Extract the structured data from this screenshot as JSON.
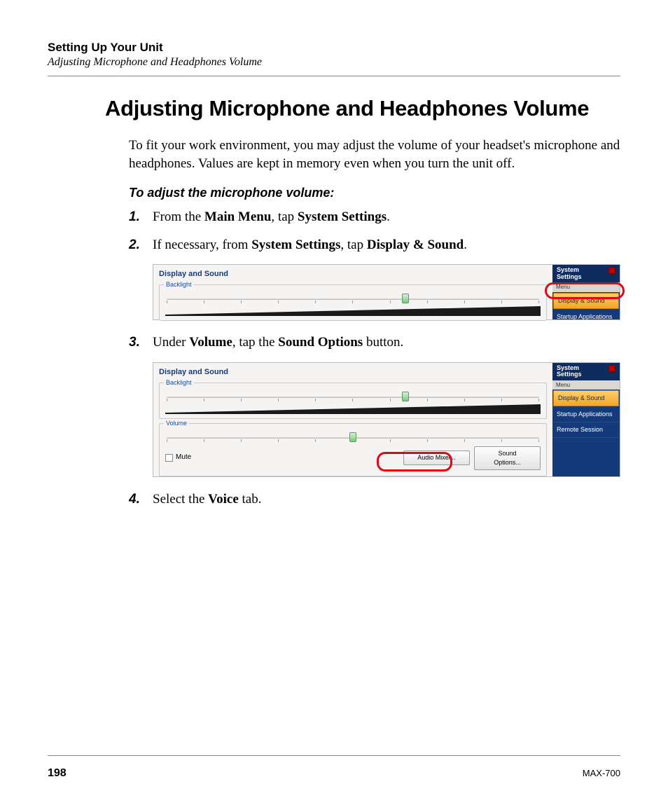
{
  "header": {
    "chapter": "Setting Up Your Unit",
    "section": "Adjusting Microphone and Headphones Volume"
  },
  "title": "Adjusting Microphone and Headphones Volume",
  "intro": "To fit your work environment, you may adjust the volume of your headset's microphone and headphones. Values are kept in memory even when you turn the unit off.",
  "subhead": "To adjust the microphone volume:",
  "steps": {
    "s1": {
      "num": "1.",
      "pre": "From the ",
      "b1": "Main Menu",
      "mid": ", tap ",
      "b2": "System Settings",
      "post": "."
    },
    "s2": {
      "num": "2.",
      "pre": "If necessary, from ",
      "b1": "System Settings",
      "mid": ", tap ",
      "b2": "Display & Sound",
      "post": "."
    },
    "s3": {
      "num": "3.",
      "pre": "Under ",
      "b1": "Volume",
      "mid": ", tap the ",
      "b2": "Sound Options",
      "post": " button."
    },
    "s4": {
      "num": "4.",
      "pre": "Select the ",
      "b1": "Voice",
      "post": " tab."
    }
  },
  "shot1": {
    "panel_title": "Display and Sound",
    "backlight_label": "Backlight",
    "sidebar_title": "System\nSettings",
    "menu_label": "Menu",
    "items": [
      "Display & Sound",
      "Startup Applications"
    ]
  },
  "shot2": {
    "panel_title": "Display and Sound",
    "backlight_label": "Backlight",
    "volume_label": "Volume",
    "mute_label": "Mute",
    "btn_audio_mixer": "Audio Mixer...",
    "btn_sound_options": "Sound Options...",
    "sidebar_title": "System\nSettings",
    "menu_label": "Menu",
    "items": [
      "Display & Sound",
      "Startup Applications",
      "Remote Session"
    ]
  },
  "footer": {
    "page": "198",
    "model": "MAX-700"
  }
}
